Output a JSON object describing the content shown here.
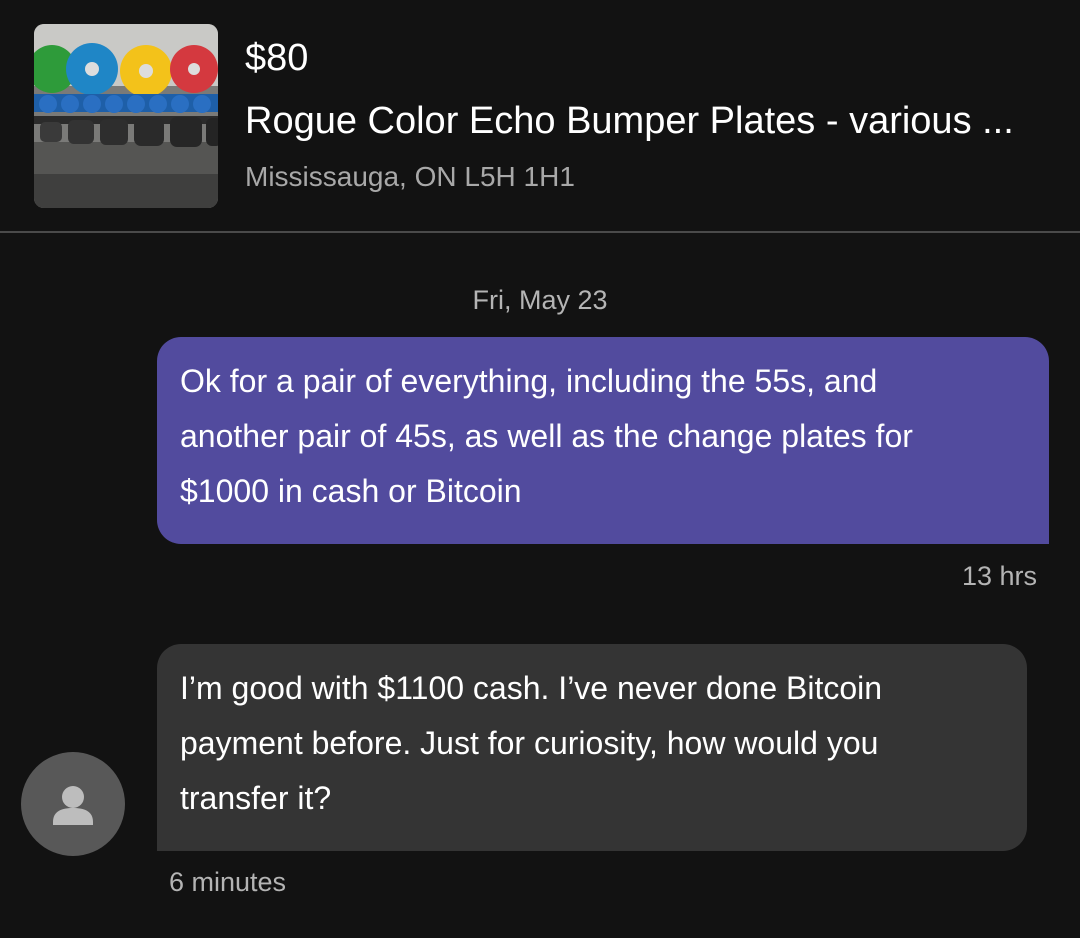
{
  "listing": {
    "price": "$80",
    "title": "Rogue Color Echo Bumper Plates - various ...",
    "location": "Mississauga, ON L5H 1H1",
    "thumbnail_icon": "listing-photo-bumper-plates"
  },
  "conversation": {
    "date_separator": "Fri, May 23",
    "messages": [
      {
        "direction": "outgoing",
        "lines": [
          "Ok for a pair of everything, including the 55s, and",
          "another pair of 45s, as well as the change plates for",
          "$1000 in cash or Bitcoin"
        ],
        "time": "13 hrs"
      },
      {
        "direction": "incoming",
        "lines": [
          "I’m good with $1100 cash.  I’ve never done Bitcoin",
          "payment before.  Just for curiosity, how would you",
          "transfer it?"
        ],
        "time": "6 minutes",
        "sender_icon": "user-avatar-icon"
      }
    ]
  },
  "colors": {
    "background": "#121212",
    "outgoing_bubble": "#524b9e",
    "incoming_bubble": "#343434",
    "secondary_text": "#b4b4b4",
    "divider": "#4a4a4a"
  }
}
